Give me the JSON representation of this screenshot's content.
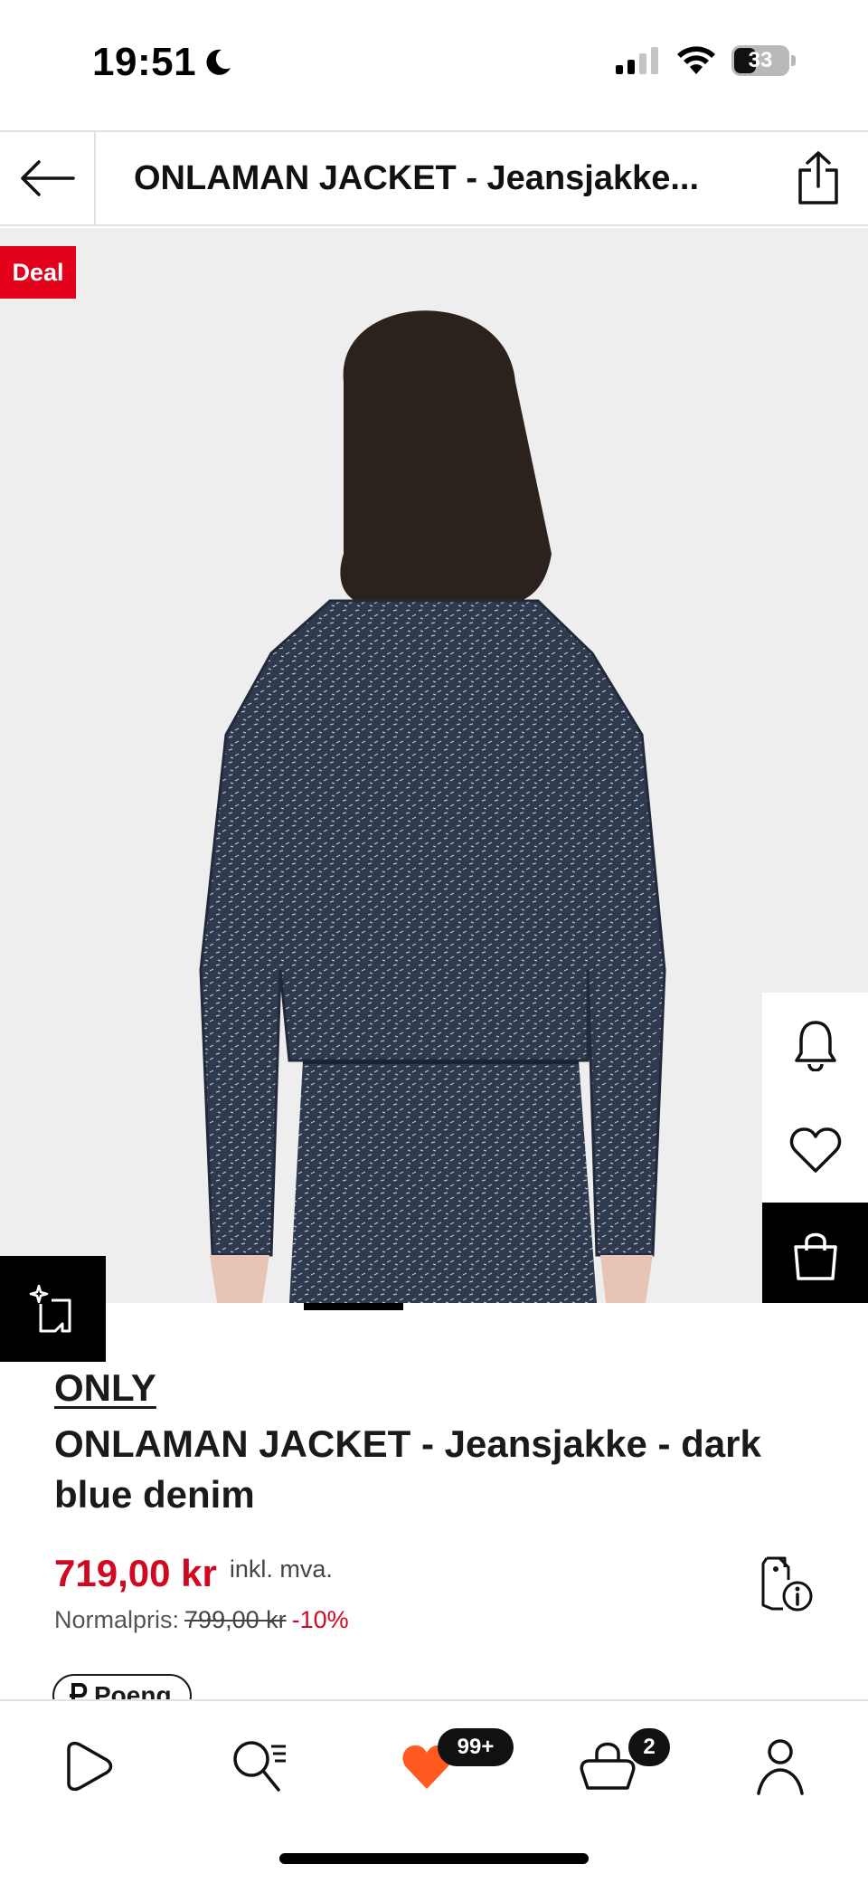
{
  "status_bar": {
    "time": "19:51",
    "battery": "33",
    "icons": [
      "moon-icon",
      "signal-icon",
      "wifi-icon",
      "battery-icon"
    ]
  },
  "header": {
    "title": "ONLAMAN JACKET - Jeansjakke...",
    "back_icon": "arrow-left-icon",
    "share_icon": "share-icon"
  },
  "gallery": {
    "deal_badge": "Deal",
    "side_actions": [
      "bell-icon",
      "heart-icon",
      "shopping-bag-icon"
    ],
    "compare_icon": "sparkle-compare-icon",
    "active_image_index": 2
  },
  "product": {
    "brand": "ONLY",
    "name": "ONLAMAN JACKET - Jeansjakke - dark blue denim",
    "price": "719,00 kr",
    "vat_label": "inkl. mva.",
    "normal_price_label": "Normalpris:",
    "normal_price": "799,00 kr",
    "discount": "-10%",
    "points_label": "Poeng"
  },
  "tab_bar": {
    "tabs": [
      {
        "name": "play-icon"
      },
      {
        "name": "search-icon"
      },
      {
        "name": "wishlist-heart-icon",
        "badge": "99+"
      },
      {
        "name": "bag-icon",
        "badge": "2"
      },
      {
        "name": "profile-icon"
      }
    ]
  },
  "colors": {
    "sale_red": "#d1081f",
    "deal_badge": "#e2001a",
    "wishlist_orange": "#ff5a1f"
  }
}
